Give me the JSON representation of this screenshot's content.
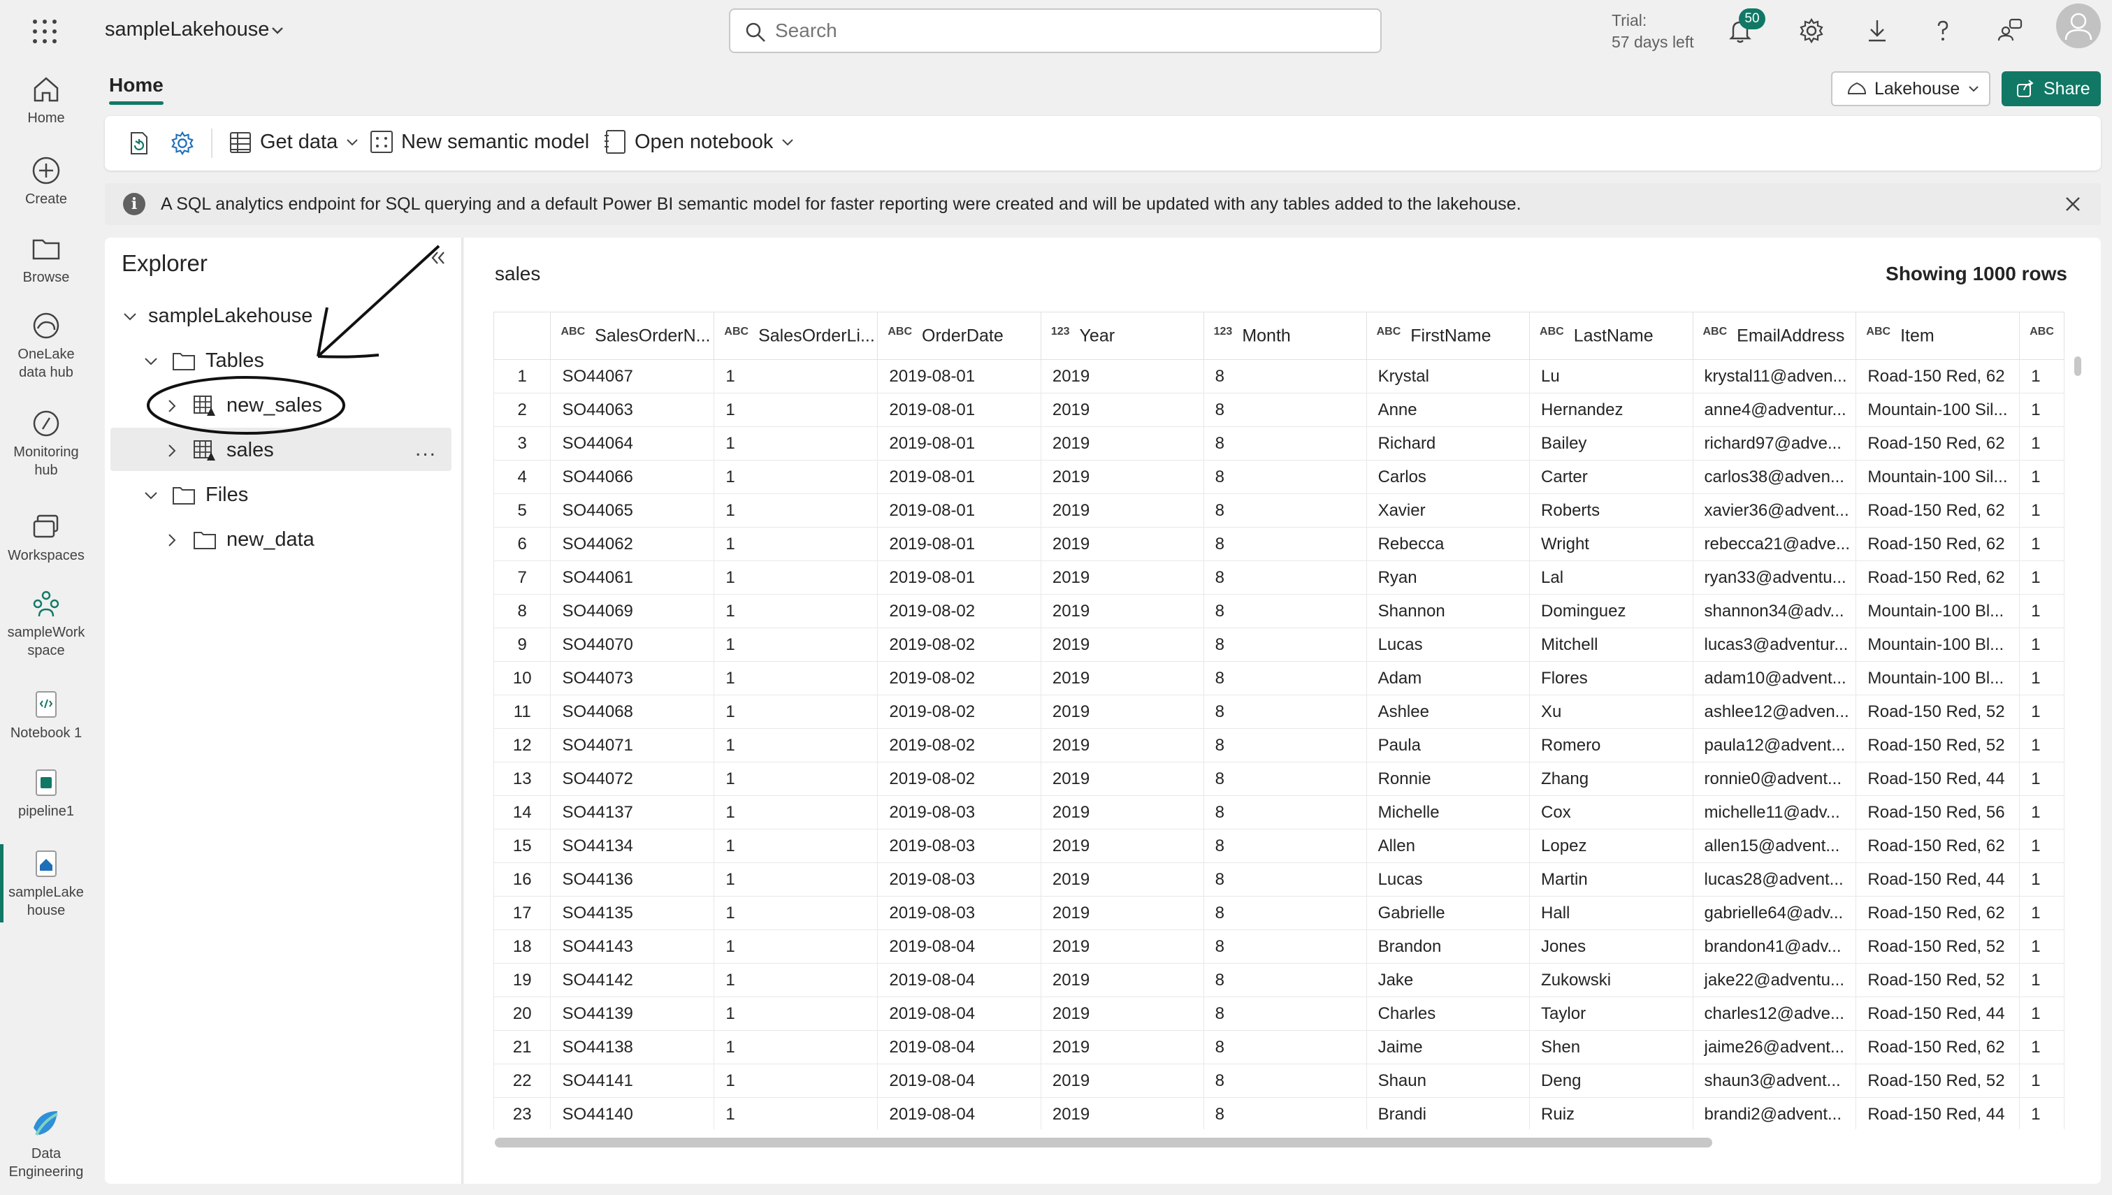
{
  "app": {
    "workspace_title": "sampleLakehouse",
    "search_placeholder": "Search",
    "trial_line1": "Trial:",
    "trial_line2": "57 days left",
    "notification_count": "50",
    "accent_color": "#117865"
  },
  "rail": {
    "items": [
      {
        "label_lines": [
          "Home"
        ],
        "icon": "home-icon"
      },
      {
        "label_lines": [
          "Create"
        ],
        "icon": "plus-circle-icon"
      },
      {
        "label_lines": [
          "Browse"
        ],
        "icon": "folder-icon"
      },
      {
        "label_lines": [
          "OneLake",
          "data hub"
        ],
        "icon": "onelake-icon"
      },
      {
        "label_lines": [
          "Monitoring",
          "hub"
        ],
        "icon": "monitor-icon"
      },
      {
        "label_lines": [
          "Workspaces"
        ],
        "icon": "workspaces-icon"
      },
      {
        "label_lines": [
          "sampleWork",
          "space"
        ],
        "icon": "people-group-icon"
      },
      {
        "label_lines": [
          "Notebook 1"
        ],
        "icon": "notebook-icon"
      },
      {
        "label_lines": [
          "pipeline1"
        ],
        "icon": "pipeline-icon"
      },
      {
        "label_lines": [
          "sampleLake",
          "house"
        ],
        "icon": "lakehouse-icon"
      },
      {
        "label_lines": [
          "Data",
          "Engineering"
        ],
        "icon": "data-engineering-icon"
      }
    ]
  },
  "header": {
    "home_tab": "Home",
    "lakehouse_button": "Lakehouse",
    "share_button": "Share"
  },
  "ribbon": {
    "get_data": "Get data",
    "new_semantic_model": "New semantic model",
    "open_notebook": "Open notebook"
  },
  "info_bar": {
    "message": "A SQL analytics endpoint for SQL querying and a default Power BI semantic model for faster reporting were created and will be updated with any tables added to the lakehouse."
  },
  "explorer": {
    "title": "Explorer",
    "root": "sampleLakehouse",
    "tables_folder": "Tables",
    "tables": [
      "new_sales",
      "sales"
    ],
    "files_folder": "Files",
    "files": [
      "new_data"
    ],
    "more_menu": "..."
  },
  "data_view": {
    "table_name": "sales",
    "row_count_text": "Showing 1000 rows",
    "columns": [
      {
        "type": "ABC",
        "name": "SalesOrderN..."
      },
      {
        "type": "ABC",
        "name": "SalesOrderLi..."
      },
      {
        "type": "ABC",
        "name": "OrderDate"
      },
      {
        "type": "123",
        "name": "Year"
      },
      {
        "type": "123",
        "name": "Month"
      },
      {
        "type": "ABC",
        "name": "FirstName"
      },
      {
        "type": "ABC",
        "name": "LastName"
      },
      {
        "type": "ABC",
        "name": "EmailAddress"
      },
      {
        "type": "ABC",
        "name": "Item"
      },
      {
        "type": "ABC",
        "name": ""
      }
    ],
    "rows": [
      [
        "1",
        "SO44067",
        "1",
        "2019-08-01",
        "2019",
        "8",
        "Krystal",
        "Lu",
        "krystal11@adven...",
        "Road-150 Red, 62",
        "1"
      ],
      [
        "2",
        "SO44063",
        "1",
        "2019-08-01",
        "2019",
        "8",
        "Anne",
        "Hernandez",
        "anne4@adventur...",
        "Mountain-100 Sil...",
        "1"
      ],
      [
        "3",
        "SO44064",
        "1",
        "2019-08-01",
        "2019",
        "8",
        "Richard",
        "Bailey",
        "richard97@adve...",
        "Road-150 Red, 62",
        "1"
      ],
      [
        "4",
        "SO44066",
        "1",
        "2019-08-01",
        "2019",
        "8",
        "Carlos",
        "Carter",
        "carlos38@adven...",
        "Mountain-100 Sil...",
        "1"
      ],
      [
        "5",
        "SO44065",
        "1",
        "2019-08-01",
        "2019",
        "8",
        "Xavier",
        "Roberts",
        "xavier36@advent...",
        "Road-150 Red, 62",
        "1"
      ],
      [
        "6",
        "SO44062",
        "1",
        "2019-08-01",
        "2019",
        "8",
        "Rebecca",
        "Wright",
        "rebecca21@adve...",
        "Road-150 Red, 62",
        "1"
      ],
      [
        "7",
        "SO44061",
        "1",
        "2019-08-01",
        "2019",
        "8",
        "Ryan",
        "Lal",
        "ryan33@adventu...",
        "Road-150 Red, 62",
        "1"
      ],
      [
        "8",
        "SO44069",
        "1",
        "2019-08-02",
        "2019",
        "8",
        "Shannon",
        "Dominguez",
        "shannon34@adv...",
        "Mountain-100 Bl...",
        "1"
      ],
      [
        "9",
        "SO44070",
        "1",
        "2019-08-02",
        "2019",
        "8",
        "Lucas",
        "Mitchell",
        "lucas3@adventur...",
        "Mountain-100 Bl...",
        "1"
      ],
      [
        "10",
        "SO44073",
        "1",
        "2019-08-02",
        "2019",
        "8",
        "Adam",
        "Flores",
        "adam10@advent...",
        "Mountain-100 Bl...",
        "1"
      ],
      [
        "11",
        "SO44068",
        "1",
        "2019-08-02",
        "2019",
        "8",
        "Ashlee",
        "Xu",
        "ashlee12@adven...",
        "Road-150 Red, 52",
        "1"
      ],
      [
        "12",
        "SO44071",
        "1",
        "2019-08-02",
        "2019",
        "8",
        "Paula",
        "Romero",
        "paula12@advent...",
        "Road-150 Red, 52",
        "1"
      ],
      [
        "13",
        "SO44072",
        "1",
        "2019-08-02",
        "2019",
        "8",
        "Ronnie",
        "Zhang",
        "ronnie0@advent...",
        "Road-150 Red, 44",
        "1"
      ],
      [
        "14",
        "SO44137",
        "1",
        "2019-08-03",
        "2019",
        "8",
        "Michelle",
        "Cox",
        "michelle11@adv...",
        "Road-150 Red, 56",
        "1"
      ],
      [
        "15",
        "SO44134",
        "1",
        "2019-08-03",
        "2019",
        "8",
        "Allen",
        "Lopez",
        "allen15@advent...",
        "Road-150 Red, 62",
        "1"
      ],
      [
        "16",
        "SO44136",
        "1",
        "2019-08-03",
        "2019",
        "8",
        "Lucas",
        "Martin",
        "lucas28@advent...",
        "Road-150 Red, 44",
        "1"
      ],
      [
        "17",
        "SO44135",
        "1",
        "2019-08-03",
        "2019",
        "8",
        "Gabrielle",
        "Hall",
        "gabrielle64@adv...",
        "Road-150 Red, 62",
        "1"
      ],
      [
        "18",
        "SO44143",
        "1",
        "2019-08-04",
        "2019",
        "8",
        "Brandon",
        "Jones",
        "brandon41@adv...",
        "Road-150 Red, 52",
        "1"
      ],
      [
        "19",
        "SO44142",
        "1",
        "2019-08-04",
        "2019",
        "8",
        "Jake",
        "Zukowski",
        "jake22@adventu...",
        "Road-150 Red, 52",
        "1"
      ],
      [
        "20",
        "SO44139",
        "1",
        "2019-08-04",
        "2019",
        "8",
        "Charles",
        "Taylor",
        "charles12@adve...",
        "Road-150 Red, 44",
        "1"
      ],
      [
        "21",
        "SO44138",
        "1",
        "2019-08-04",
        "2019",
        "8",
        "Jaime",
        "Shen",
        "jaime26@advent...",
        "Road-150 Red, 62",
        "1"
      ],
      [
        "22",
        "SO44141",
        "1",
        "2019-08-04",
        "2019",
        "8",
        "Shaun",
        "Deng",
        "shaun3@advent...",
        "Road-150 Red, 52",
        "1"
      ],
      [
        "23",
        "SO44140",
        "1",
        "2019-08-04",
        "2019",
        "8",
        "Brandi",
        "Ruiz",
        "brandi2@advent...",
        "Road-150 Red, 44",
        "1"
      ]
    ]
  }
}
